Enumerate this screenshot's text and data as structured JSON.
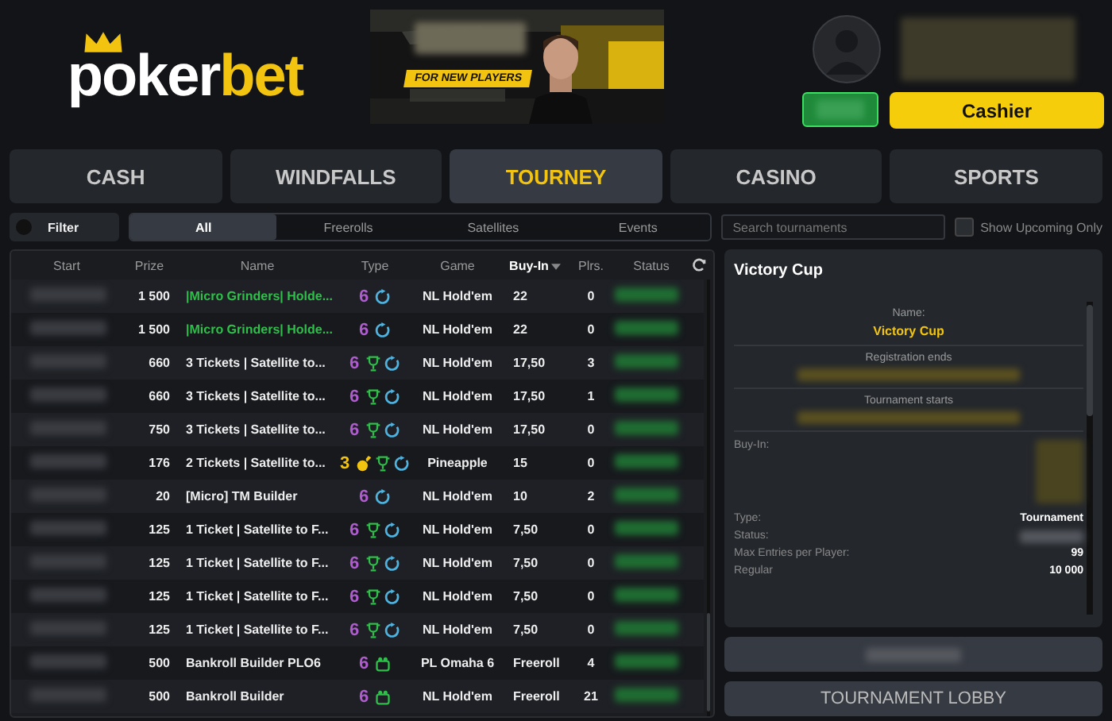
{
  "logo": {
    "part1": "poker",
    "part2": "bet"
  },
  "banner": {
    "kind": "picture",
    "badge": "FOR NEW PLAYERS"
  },
  "account": {
    "cashier": "Cashier"
  },
  "tabs": [
    {
      "label": "CASH",
      "selected": false
    },
    {
      "label": "WINDFALLS",
      "selected": false
    },
    {
      "label": "TOURNEY",
      "selected": true
    },
    {
      "label": "CASINO",
      "selected": false
    },
    {
      "label": "SPORTS",
      "selected": false
    }
  ],
  "filter": {
    "label": "Filter",
    "on": false
  },
  "subtabs": [
    {
      "label": "All",
      "selected": true
    },
    {
      "label": "Freerolls",
      "selected": false
    },
    {
      "label": "Satellites",
      "selected": false
    },
    {
      "label": "Events",
      "selected": false
    }
  ],
  "search": {
    "placeholder": "Search tournaments"
  },
  "upcoming": {
    "label": "Show Upcoming Only",
    "checked": false
  },
  "table": {
    "columns": [
      {
        "label": "Start",
        "sorted": false
      },
      {
        "label": "Prize",
        "sorted": false
      },
      {
        "label": "Name",
        "sorted": false
      },
      {
        "label": "Type",
        "sorted": false
      },
      {
        "label": "Game",
        "sorted": false
      },
      {
        "label": "Buy-In",
        "sorted": true
      },
      {
        "label": "Plrs.",
        "sorted": false
      },
      {
        "label": "Status",
        "sorted": false
      }
    ],
    "rows": [
      {
        "prize": "1 500",
        "name": "|Micro Grinders| Holde...",
        "highlighted": true,
        "count": "6",
        "color": "#b05cd0",
        "icons": [
          {
            "kind": "reentry"
          }
        ],
        "game": "NL Hold'em",
        "buyin": "22",
        "players": "0"
      },
      {
        "prize": "1 500",
        "name": "|Micro Grinders| Holde...",
        "highlighted": true,
        "count": "6",
        "color": "#b05cd0",
        "icons": [
          {
            "kind": "reentry"
          }
        ],
        "game": "NL Hold'em",
        "buyin": "22",
        "players": "0"
      },
      {
        "prize": "660",
        "name": "3 Tickets | Satellite to...",
        "highlighted": false,
        "count": "6",
        "color": "#b05cd0",
        "icons": [
          {
            "kind": "trophy"
          },
          {
            "kind": "reentry"
          }
        ],
        "game": "NL Hold'em",
        "buyin": "17,50",
        "players": "3"
      },
      {
        "prize": "660",
        "name": "3 Tickets | Satellite to...",
        "highlighted": false,
        "count": "6",
        "color": "#b05cd0",
        "icons": [
          {
            "kind": "trophy"
          },
          {
            "kind": "reentry"
          }
        ],
        "game": "NL Hold'em",
        "buyin": "17,50",
        "players": "1"
      },
      {
        "prize": "750",
        "name": "3 Tickets | Satellite to...",
        "highlighted": false,
        "count": "6",
        "color": "#b05cd0",
        "icons": [
          {
            "kind": "trophy"
          },
          {
            "kind": "reentry"
          }
        ],
        "game": "NL Hold'em",
        "buyin": "17,50",
        "players": "0"
      },
      {
        "prize": "176",
        "name": "2 Tickets | Satellite to...",
        "highlighted": false,
        "count": "3",
        "color": "#f2c40f",
        "icons": [
          {
            "kind": "pineapple"
          },
          {
            "kind": "trophy"
          },
          {
            "kind": "reentry"
          }
        ],
        "game": "Pineapple",
        "buyin": "15",
        "players": "0"
      },
      {
        "prize": "20",
        "name": "[Micro] TM Builder",
        "highlighted": false,
        "count": "6",
        "color": "#b05cd0",
        "icons": [
          {
            "kind": "reentry"
          }
        ],
        "game": "NL Hold'em",
        "buyin": "10",
        "players": "2"
      },
      {
        "prize": "125",
        "name": "1 Ticket | Satellite to F...",
        "highlighted": false,
        "count": "6",
        "color": "#b05cd0",
        "icons": [
          {
            "kind": "trophy"
          },
          {
            "kind": "reentry"
          }
        ],
        "game": "NL Hold'em",
        "buyin": "7,50",
        "players": "0"
      },
      {
        "prize": "125",
        "name": "1 Ticket | Satellite to F...",
        "highlighted": false,
        "count": "6",
        "color": "#b05cd0",
        "icons": [
          {
            "kind": "trophy"
          },
          {
            "kind": "reentry"
          }
        ],
        "game": "NL Hold'em",
        "buyin": "7,50",
        "players": "0"
      },
      {
        "prize": "125",
        "name": "1 Ticket | Satellite to F...",
        "highlighted": false,
        "count": "6",
        "color": "#b05cd0",
        "icons": [
          {
            "kind": "trophy"
          },
          {
            "kind": "reentry"
          }
        ],
        "game": "NL Hold'em",
        "buyin": "7,50",
        "players": "0"
      },
      {
        "prize": "125",
        "name": "1 Ticket | Satellite to F...",
        "highlighted": false,
        "count": "6",
        "color": "#b05cd0",
        "icons": [
          {
            "kind": "trophy"
          },
          {
            "kind": "reentry"
          }
        ],
        "game": "NL Hold'em",
        "buyin": "7,50",
        "players": "0"
      },
      {
        "prize": "500",
        "name": "Bankroll Builder PLO6",
        "highlighted": false,
        "count": "6",
        "color": "#b05cd0",
        "icons": [
          {
            "kind": "bag"
          }
        ],
        "game": "PL Omaha 6",
        "buyin": "Freeroll",
        "players": "4"
      },
      {
        "prize": "500",
        "name": "Bankroll Builder",
        "highlighted": false,
        "count": "6",
        "color": "#b05cd0",
        "icons": [
          {
            "kind": "bag"
          }
        ],
        "game": "NL Hold'em",
        "buyin": "Freeroll",
        "players": "21"
      }
    ]
  },
  "details": {
    "title": "Victory Cup",
    "sections": [
      {
        "label": "Name:",
        "value": "Victory Cup"
      },
      {
        "label": "Registration ends"
      },
      {
        "label": "Tournament starts"
      }
    ],
    "buyin_label": "Buy-In:",
    "rows": [
      {
        "label": "Type:",
        "value": "Tournament"
      },
      {
        "label": "Status:"
      },
      {
        "label": "Max Entries per Player:",
        "value": "99"
      },
      {
        "label": "Regular",
        "value": "10 000"
      }
    ]
  },
  "lobby_button": "TOURNAMENT LOBBY"
}
